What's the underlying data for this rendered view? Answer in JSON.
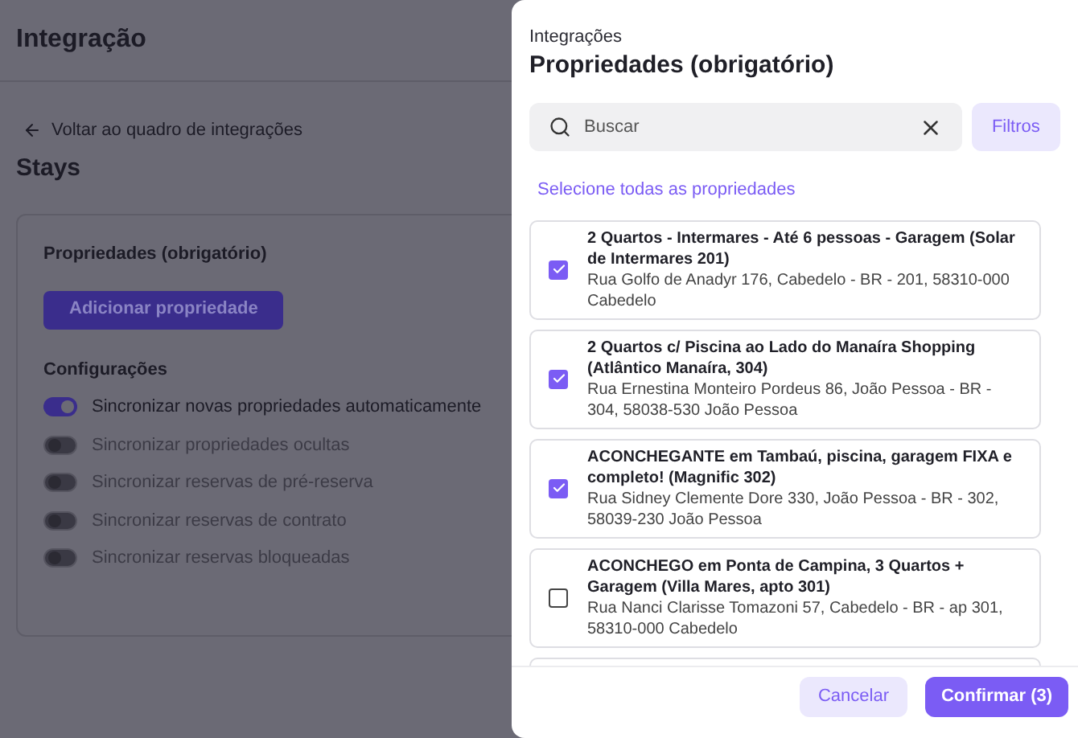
{
  "page": {
    "title": "Integração",
    "back_link": "Voltar ao quadro de integrações",
    "heading": "Stays",
    "card": {
      "section_title": "Propriedades (obrigatório)",
      "add_button": "Adicionar propriedade",
      "settings_title": "Configurações",
      "settings": [
        {
          "label": "Sincronizar novas propriedades automaticamente",
          "on": true,
          "disabled": false
        },
        {
          "label": "Sincronizar propriedades ocultas",
          "on": false,
          "disabled": true
        },
        {
          "label": "Sincronizar reservas de pré-reserva",
          "on": false,
          "disabled": true
        },
        {
          "label": "Sincronizar reservas de contrato",
          "on": false,
          "disabled": true
        },
        {
          "label": "Sincronizar reservas bloqueadas",
          "on": false,
          "disabled": true
        }
      ]
    }
  },
  "drawer": {
    "subtitle": "Integrações",
    "title": "Propriedades (obrigatório)",
    "search": {
      "placeholder": "Buscar"
    },
    "filter_button": "Filtros",
    "select_all": "Selecione todas as propriedades",
    "properties": [
      {
        "name": "2 Quartos - Intermares - Até 6 pessoas - Garagem (Solar de Intermares 201)",
        "address": "Rua Golfo de Anadyr 176, Cabedelo - BR - 201, 58310-000 Cabedelo",
        "checked": true
      },
      {
        "name": "2 Quartos c/ Piscina ao Lado do Manaíra Shopping (Atlântico Manaíra, 304)",
        "address": "Rua Ernestina Monteiro Pordeus 86, João Pessoa - BR - 304, 58038-530 João Pessoa",
        "checked": true
      },
      {
        "name": "ACONCHEGANTE em Tambaú, piscina, garagem FIXA e completo! (Magnific 302)",
        "address": "Rua Sidney Clemente Dore 330, João Pessoa - BR - 302, 58039-230 João Pessoa",
        "checked": true
      },
      {
        "name": "ACONCHEGO em Ponta de Campina, 3 Quartos + Garagem (Villa Mares, apto 301)",
        "address": "Rua Nanci Clarisse Tomazoni 57, Cabedelo - BR - ap 301, 58310-000 Cabedelo",
        "checked": false
      }
    ],
    "cancel_button": "Cancelar",
    "confirm_button": "Confirmar (3)"
  }
}
